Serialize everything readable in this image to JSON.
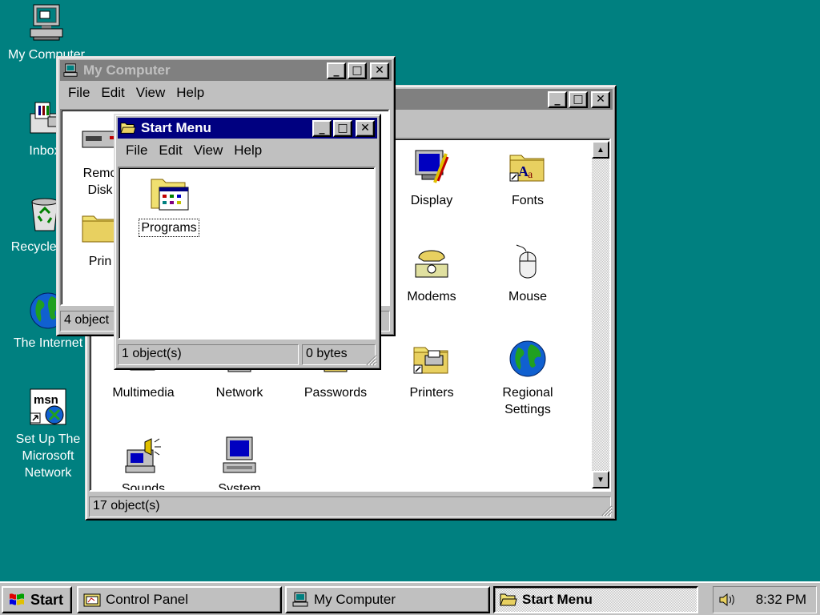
{
  "colors": {
    "desktop": "#008080",
    "active_title": "#000080",
    "inactive_title": "#808080",
    "face": "#c0c0c0"
  },
  "desktop": {
    "icons": [
      {
        "label": "My Computer",
        "icon": "computer-icon"
      },
      {
        "label": "Inbox",
        "icon": "inbox-icon"
      },
      {
        "label": "Recycle Bin",
        "icon": "recycle-bin-icon"
      },
      {
        "label": "The Internet",
        "icon": "globe-icon"
      },
      {
        "label": "Set Up The\nMicrosoft\nNetwork",
        "icon": "msn-icon"
      }
    ]
  },
  "control_panel": {
    "title": "Control Panel",
    "items": [
      {
        "label": "Display",
        "icon": "display-icon"
      },
      {
        "label": "Fonts",
        "icon": "fonts-folder-icon"
      },
      {
        "label": "Modems",
        "icon": "modem-phone-icon"
      },
      {
        "label": "Mouse",
        "icon": "mouse-icon"
      },
      {
        "label": "Multimedia",
        "icon": "multimedia-icon"
      },
      {
        "label": "Network",
        "icon": "network-icon"
      },
      {
        "label": "Passwords",
        "icon": "passwords-icon"
      },
      {
        "label": "Printers",
        "icon": "printers-folder-icon"
      },
      {
        "label": "Regional\nSettings",
        "icon": "globe-icon"
      },
      {
        "label": "Sounds",
        "icon": "sounds-icon"
      },
      {
        "label": "System",
        "icon": "system-computer-icon"
      }
    ],
    "status": "17 object(s)"
  },
  "my_computer": {
    "title": "My Computer",
    "menu": [
      "File",
      "Edit",
      "View",
      "Help"
    ],
    "items": [
      {
        "label": "Remo\nDisk",
        "icon": "removable-disk-icon"
      },
      {
        "label": "Prin",
        "icon": "printers-folder-icon"
      }
    ],
    "status": "4 object"
  },
  "start_menu_window": {
    "title": "Start Menu",
    "menu": [
      "File",
      "Edit",
      "View",
      "Help"
    ],
    "items": [
      {
        "label": "Programs",
        "icon": "programs-folder-icon"
      }
    ],
    "status_count": "1 object(s)",
    "status_size": "0 bytes"
  },
  "taskbar": {
    "start_label": "Start",
    "buttons": [
      {
        "label": "Control Panel",
        "icon": "control-panel-icon"
      },
      {
        "label": "My Computer",
        "icon": "computer-icon"
      },
      {
        "label": "Start Menu",
        "icon": "folder-open-icon",
        "active": true
      }
    ],
    "clock": "8:32 PM"
  },
  "window_controls": {
    "minimize": "_",
    "maximize": "□",
    "close": "✕"
  }
}
